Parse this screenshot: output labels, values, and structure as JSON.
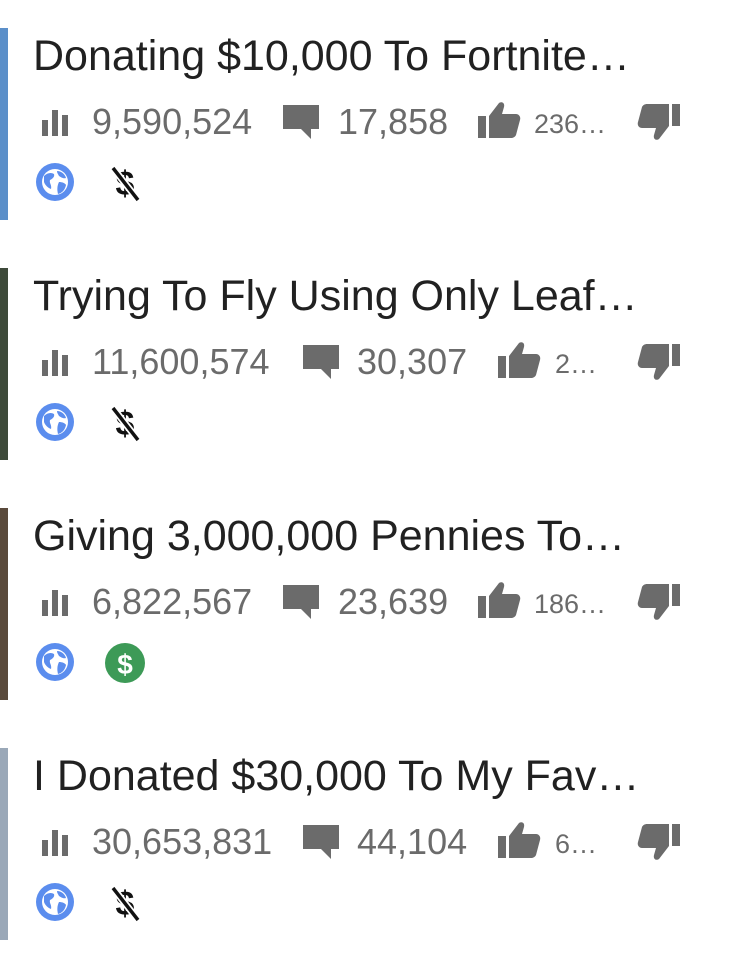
{
  "videos": [
    {
      "title": "Donating $10,000 To Fortnite…",
      "views": "9,590,524",
      "comments": "17,858",
      "likes": "236…",
      "monetized": false,
      "thumb_color": "#5b8fc9"
    },
    {
      "title": "Trying To Fly Using Only Leaf…",
      "views": "11,600,574",
      "comments": "30,307",
      "likes": "2…",
      "monetized": false,
      "thumb_color": "#3e4a3a"
    },
    {
      "title": "Giving 3,000,000 Pennies To…",
      "views": "6,822,567",
      "comments": "23,639",
      "likes": "186…",
      "monetized": true,
      "thumb_color": "#5a4a3c"
    },
    {
      "title": "I Donated $30,000 To My Fav…",
      "views": "30,653,831",
      "comments": "44,104",
      "likes": "6…",
      "monetized": false,
      "thumb_color": "#9aa8b8"
    }
  ],
  "colors": {
    "icon_gray": "#6b6b6b",
    "globe_blue": "#5b8dee",
    "money_green": "#3d9a57"
  },
  "icons": {
    "views": "bar-chart-icon",
    "comments": "comment-icon",
    "likes": "thumbs-up-icon",
    "dislikes": "thumbs-down-icon",
    "public": "globe-icon",
    "monetization": "dollar-icon"
  }
}
